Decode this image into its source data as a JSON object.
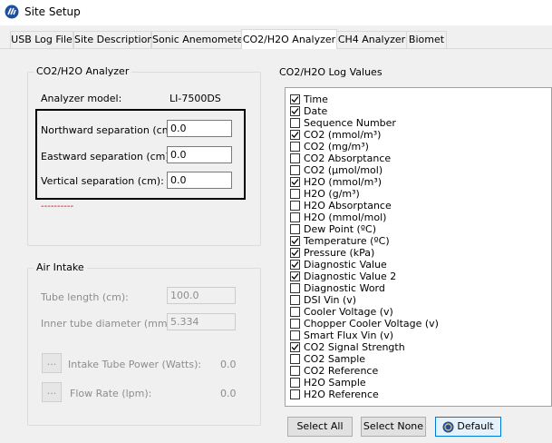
{
  "window": {
    "title": "Site Setup"
  },
  "tabs": [
    {
      "label": "USB Log File"
    },
    {
      "label": "Site Description"
    },
    {
      "label": "Sonic Anemometer"
    },
    {
      "label": "CO2/H2O Analyzer",
      "active": true
    },
    {
      "label": "CH4 Analyzer"
    },
    {
      "label": "Biomet"
    }
  ],
  "analyzer_group": {
    "title": "CO2/H2O Analyzer",
    "model_label": "Analyzer model:",
    "model_value": "LI-7500DS",
    "northward_label": "Northward separation (cm):",
    "northward_value": "0.0",
    "eastward_label": "Eastward separation (cm):",
    "eastward_value": "0.0",
    "vertical_label": "Vertical separation (cm):",
    "vertical_value": "0.0",
    "error_marker": "----------"
  },
  "air_intake": {
    "title": "Air Intake",
    "tube_length_label": "Tube length (cm):",
    "tube_length_value": "100.0",
    "inner_diameter_label": "Inner tube diameter (mm):",
    "inner_diameter_value": "5.334",
    "intake_power_button": "...",
    "intake_power_label": "Intake Tube Power (Watts):",
    "intake_power_value": "0.0",
    "flow_rate_button": "...",
    "flow_rate_label": "Flow Rate (lpm):",
    "flow_rate_value": "0.0"
  },
  "log_values": {
    "title": "CO2/H2O Log Values",
    "items": [
      {
        "label": "Time",
        "checked": true
      },
      {
        "label": "Date",
        "checked": true
      },
      {
        "label": "Sequence Number",
        "checked": false
      },
      {
        "label": "CO2 (mmol/m³)",
        "checked": true
      },
      {
        "label": "CO2 (mg/m³)",
        "checked": false
      },
      {
        "label": "CO2 Absorptance",
        "checked": false
      },
      {
        "label": "CO2 (µmol/mol)",
        "checked": false
      },
      {
        "label": "H2O (mmol/m³)",
        "checked": true
      },
      {
        "label": "H2O (g/m³)",
        "checked": false
      },
      {
        "label": "H2O Absorptance",
        "checked": false
      },
      {
        "label": "H2O (mmol/mol)",
        "checked": false
      },
      {
        "label": "Dew Point (ºC)",
        "checked": false
      },
      {
        "label": "Temperature (ºC)",
        "checked": true
      },
      {
        "label": "Pressure (kPa)",
        "checked": true
      },
      {
        "label": "Diagnostic Value",
        "checked": true
      },
      {
        "label": "Diagnostic Value 2",
        "checked": true
      },
      {
        "label": "Diagnostic Word",
        "checked": false
      },
      {
        "label": "DSI Vin (v)",
        "checked": false
      },
      {
        "label": "Cooler Voltage (v)",
        "checked": false
      },
      {
        "label": "Chopper Cooler Voltage (v)",
        "checked": false
      },
      {
        "label": "Smart Flux Vin (v)",
        "checked": false
      },
      {
        "label": "CO2 Signal Strength",
        "checked": true
      },
      {
        "label": "CO2 Sample",
        "checked": false
      },
      {
        "label": "CO2 Reference",
        "checked": false
      },
      {
        "label": "H2O Sample",
        "checked": false
      },
      {
        "label": "H2O Reference",
        "checked": false
      }
    ],
    "select_all": "Select All",
    "select_none": "Select None",
    "default": "Default"
  }
}
